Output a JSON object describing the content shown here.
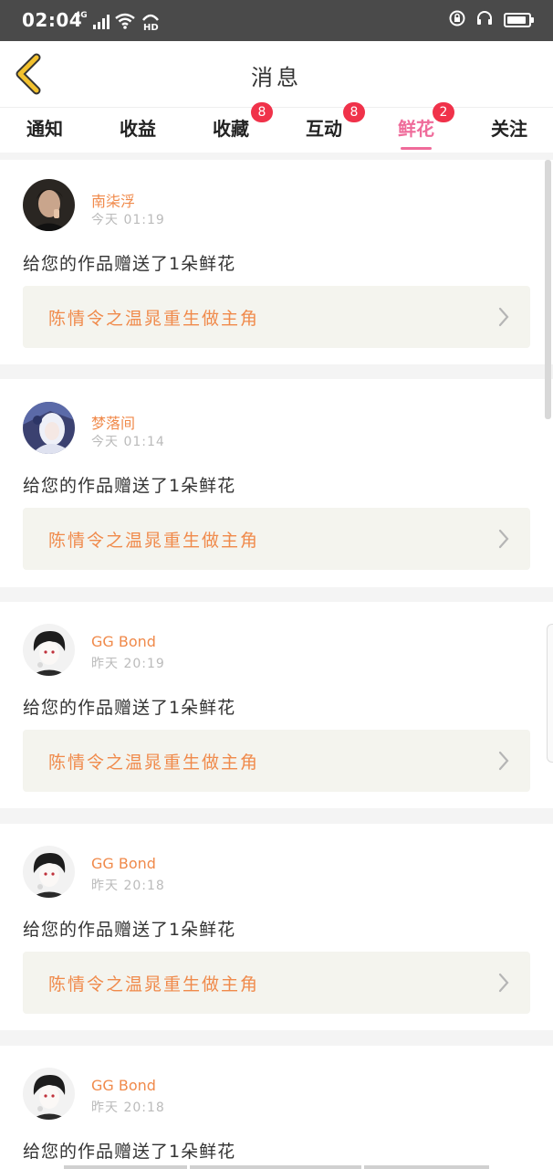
{
  "status_bar": {
    "time": "02:04",
    "network": "4G",
    "hd": "HD",
    "battery_level": 0.9
  },
  "header": {
    "title": "消息"
  },
  "tabs": [
    {
      "label": "通知",
      "badge": ""
    },
    {
      "label": "收益",
      "badge": ""
    },
    {
      "label": "收藏",
      "badge": "8"
    },
    {
      "label": "互动",
      "badge": "8"
    },
    {
      "label": "鲜花",
      "badge": "2",
      "active": true
    },
    {
      "label": "关注",
      "badge": ""
    }
  ],
  "feed": [
    {
      "username": "南柒浮",
      "time": "今天 01:19",
      "message": "给您的作品赠送了1朵鲜花",
      "work_title": "陈情令之温晁重生做主角",
      "avatar": "dark-portrait-avatar"
    },
    {
      "username": "梦落间",
      "time": "今天 01:14",
      "message": "给您的作品赠送了1朵鲜花",
      "work_title": "陈情令之温晁重生做主角",
      "avatar": "anime-girl-avatar"
    },
    {
      "username": "GG Bond",
      "time": "昨天 20:19",
      "message": "给您的作品赠送了1朵鲜花",
      "work_title": "陈情令之温晁重生做主角",
      "avatar": "anime-boy-avatar"
    },
    {
      "username": "GG Bond",
      "time": "昨天 20:18",
      "message": "给您的作品赠送了1朵鲜花",
      "work_title": "陈情令之温晁重生做主角",
      "avatar": "anime-boy-avatar"
    },
    {
      "username": "GG Bond",
      "time": "昨天 20:18",
      "message": "给您的作品赠送了1朵鲜花",
      "work_title": "",
      "avatar": "anime-boy-avatar"
    }
  ],
  "colors": {
    "accent_pink": "#ef6b9a",
    "badge_red": "#f0324a",
    "name_orange": "#f08a4b",
    "back_yellow": "#f2c12e"
  }
}
